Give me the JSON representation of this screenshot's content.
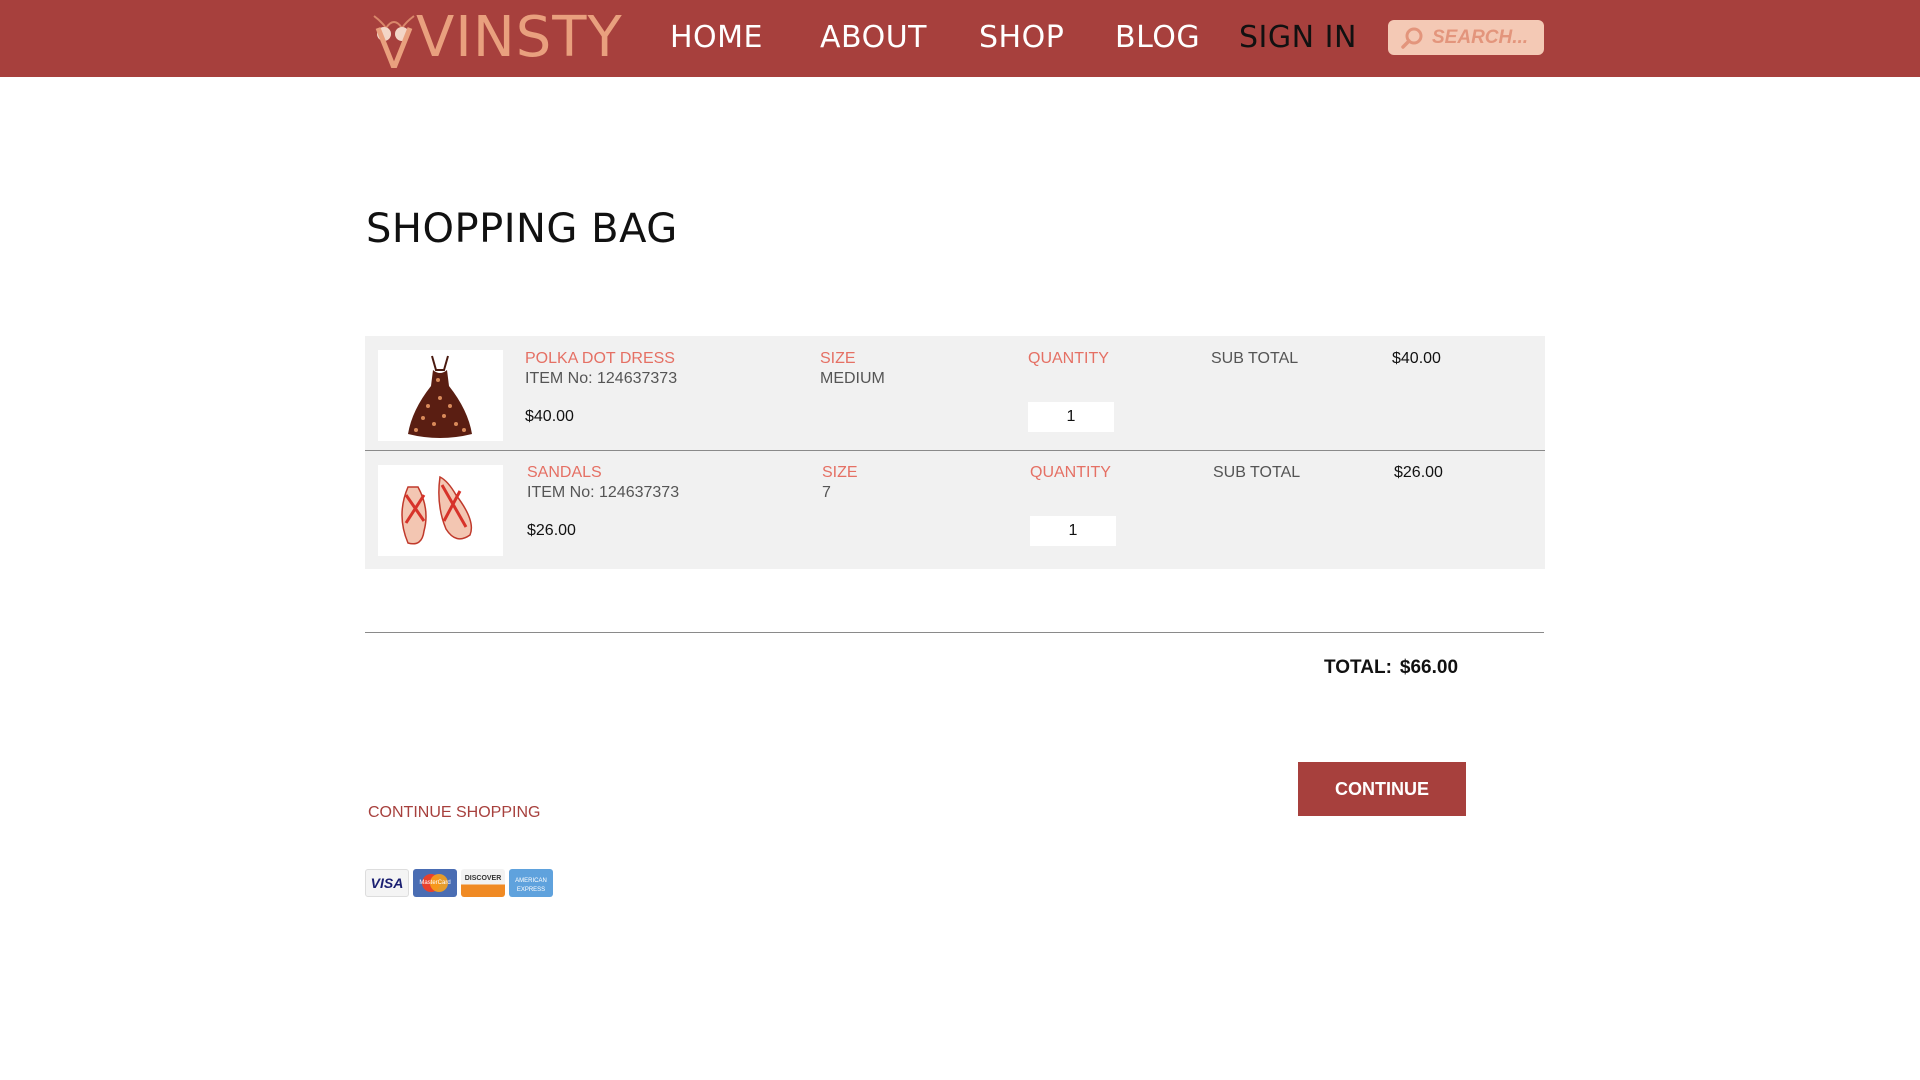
{
  "brand": {
    "name": "VINSTY",
    "accent": "#a7403d",
    "logo_color": "#e9a07e"
  },
  "nav": {
    "items": [
      {
        "label": "HOME"
      },
      {
        "label": "ABOUT"
      },
      {
        "label": "SHOP"
      },
      {
        "label": "BLOG"
      },
      {
        "label": "SIGN IN"
      }
    ]
  },
  "search": {
    "placeholder": "SEARCH...",
    "icon": "search-icon"
  },
  "page": {
    "title": "SHOPPING BAG"
  },
  "cart": {
    "items": [
      {
        "name": "POLKA DOT DRESS",
        "item_no": "ITEM No: 124637373",
        "price": "$40.00",
        "size_label": "SIZE",
        "size": "MEDIUM",
        "quantity_label": "QUANTITY",
        "quantity": "1",
        "subtotal_label": "SUB TOTAL",
        "subtotal": "$40.00",
        "image": "polka-dot-dress-image"
      },
      {
        "name": "SANDALS",
        "item_no": "ITEM No: 124637373",
        "price": "$26.00",
        "size_label": "SIZE",
        "size": "7",
        "quantity_label": "QUANTITY",
        "quantity": "1",
        "subtotal_label": "SUB TOTAL",
        "subtotal": "$26.00",
        "image": "sandals-image"
      }
    ]
  },
  "summary": {
    "total_label": "TOTAL:",
    "total": "$66.00"
  },
  "actions": {
    "continue_label": "CONTINUE",
    "continue_shopping_label": "CONTINUE SHOPPING"
  },
  "payment_cards": {
    "visa": "VISA",
    "mastercard": "MasterCard",
    "discover": "DISCOVER",
    "amex": "AMERICAN EXPRESS"
  }
}
